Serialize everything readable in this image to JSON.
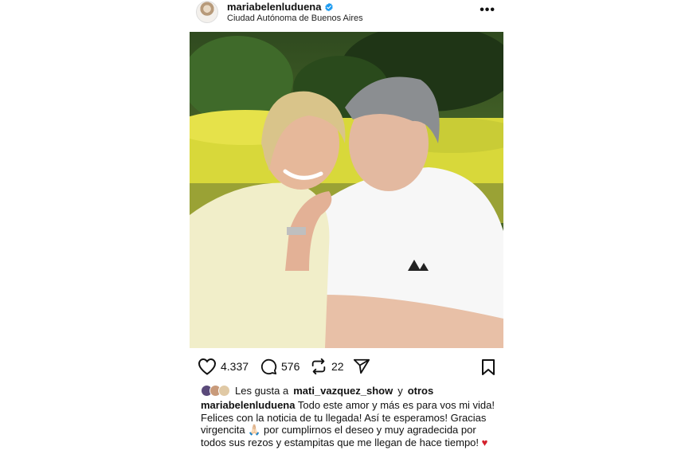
{
  "post": {
    "username": "mariabelenluduena",
    "location": "Ciudad Autónoma de Buenos Aires",
    "more_label": "•••",
    "stats": {
      "likes": "4.337",
      "comments": "576",
      "reposts": "22"
    },
    "liked_by": {
      "prefix": "Les gusta a",
      "user": "mati_vazquez_show",
      "joiner": "y",
      "others": "otros"
    },
    "caption": {
      "username": "mariabelenluduena",
      "text": "Todo este amor y más  es para vos mi vida! Felices con la noticia de tu llegada! Así te esperamos! Gracias virgencita 🙏🏻 por cumplirnos el deseo y muy agradecida por todos sus rezos y estampitas que me llegan de hace tiempo!",
      "emoji_end": "♥"
    },
    "icons": [
      "heart-outline-icon",
      "comment-icon",
      "repost-icon",
      "share-icon",
      "bookmark-icon",
      "verified-badge-icon"
    ],
    "colors": {
      "verified": "#1d9bf0",
      "heart": "#d3202b"
    }
  }
}
